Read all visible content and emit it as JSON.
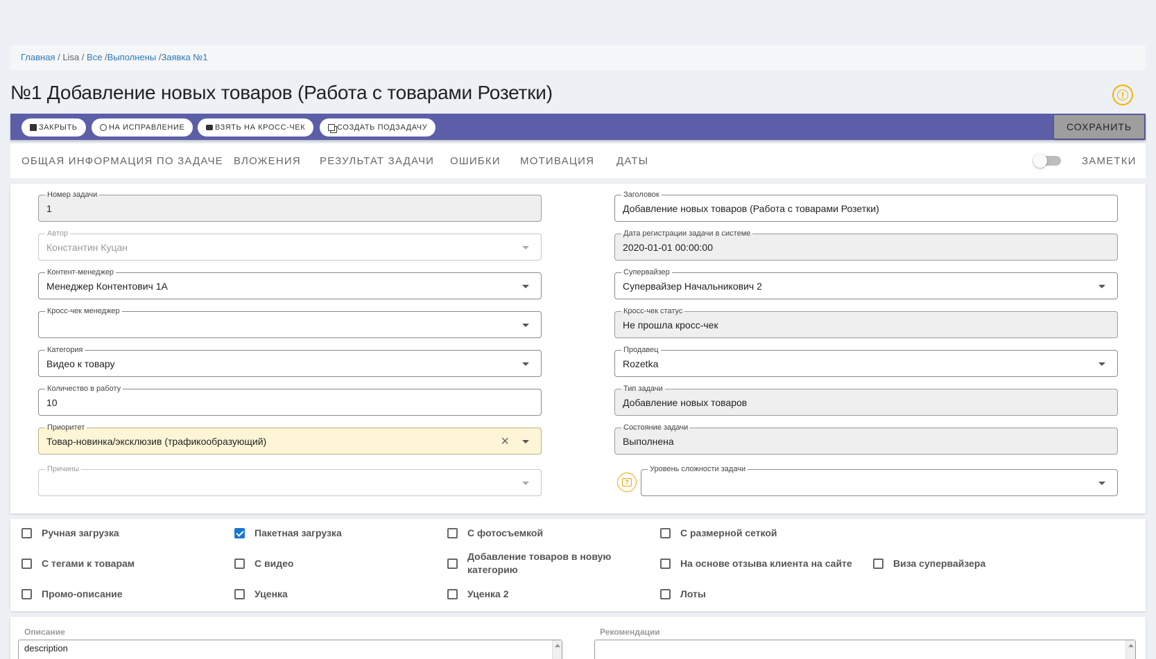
{
  "breadcrumb": {
    "home": "Главная",
    "sep1": " / ",
    "user": "Lisa",
    "sep2": " / ",
    "all": "Все",
    "sep3": " /",
    "done": "Выполнены",
    "sep4": " /",
    "current": "Заявка №1"
  },
  "page": {
    "title": "№1 Добавление новых товаров (Работа с товарами Розетки)"
  },
  "toolbar": {
    "close": "Закрыть",
    "fix": "На исправление",
    "cross_check": "Взять на кросс-чек",
    "subtask": "Создать подзадачу",
    "save": "Сохранить"
  },
  "tabs": {
    "general": "Общая информация по задаче",
    "attachments": "Вложения",
    "result": "Результат задачи",
    "errors": "Ошибки",
    "motivation": "Мотивация",
    "dates": "Даты",
    "notes": "Заметки"
  },
  "form": {
    "task_number": {
      "label": "Номер задачи",
      "value": "1"
    },
    "author": {
      "label": "Автор",
      "value": "Константин Куцан"
    },
    "content_manager": {
      "label": "Контент-менеджер",
      "value": "Менеджер Контентович 1А"
    },
    "cross_manager": {
      "label": "Кросс-чек менеджер",
      "value": ""
    },
    "category": {
      "label": "Категория",
      "value": "Видео к товару"
    },
    "quantity": {
      "label": "Количество в работу",
      "value": "10"
    },
    "priority": {
      "label": "Приоритет",
      "value": "Товар-новинка/эксклюзив (трафикообразующий)"
    },
    "reasons": {
      "label": "Причины",
      "value": ""
    },
    "heading": {
      "label": "Заголовок",
      "value": "Добавление новых товаров (Работа с товарами Розетки)"
    },
    "reg_date": {
      "label": "Дата регистрации задачи в системе",
      "value": "2020-01-01 00:00:00"
    },
    "supervisor": {
      "label": "Супервайзер",
      "value": "Супервайзер Начальникович 2"
    },
    "cross_status": {
      "label": "Кросс-чек статус",
      "value": "Не прошла кросс-чек"
    },
    "seller": {
      "label": "Продавец",
      "value": "Rozetka"
    },
    "task_type": {
      "label": "Тип задачи",
      "value": "Добавление новых товаров"
    },
    "task_state": {
      "label": "Состояние задачи",
      "value": "Выполнена"
    },
    "complexity": {
      "label": "Уровень сложности задачи",
      "value": ""
    }
  },
  "checkboxes": [
    {
      "label": "Ручная загрузка",
      "checked": false
    },
    {
      "label": "Пакетная загрузка",
      "checked": true
    },
    {
      "label": "С фотосъемкой",
      "checked": false
    },
    {
      "label": "С размерной сеткой",
      "checked": false
    },
    {
      "label": "С тегами к товарам",
      "checked": false
    },
    {
      "label": "С видео",
      "checked": false
    },
    {
      "label": "Добавление товаров в новую категорию",
      "checked": false
    },
    {
      "label": "На основе отзыва клиента на сайте",
      "checked": false
    },
    {
      "label": "Виза супервайзера",
      "checked": false
    },
    {
      "label": "Промо-описание",
      "checked": false
    },
    {
      "label": "Уценка",
      "checked": false
    },
    {
      "label": "Уценка 2",
      "checked": false
    },
    {
      "label": "Лоты",
      "checked": false
    }
  ],
  "description": {
    "label": "Описание",
    "value": "description"
  },
  "recommendations": {
    "label": "Рекомендации",
    "value": ""
  }
}
